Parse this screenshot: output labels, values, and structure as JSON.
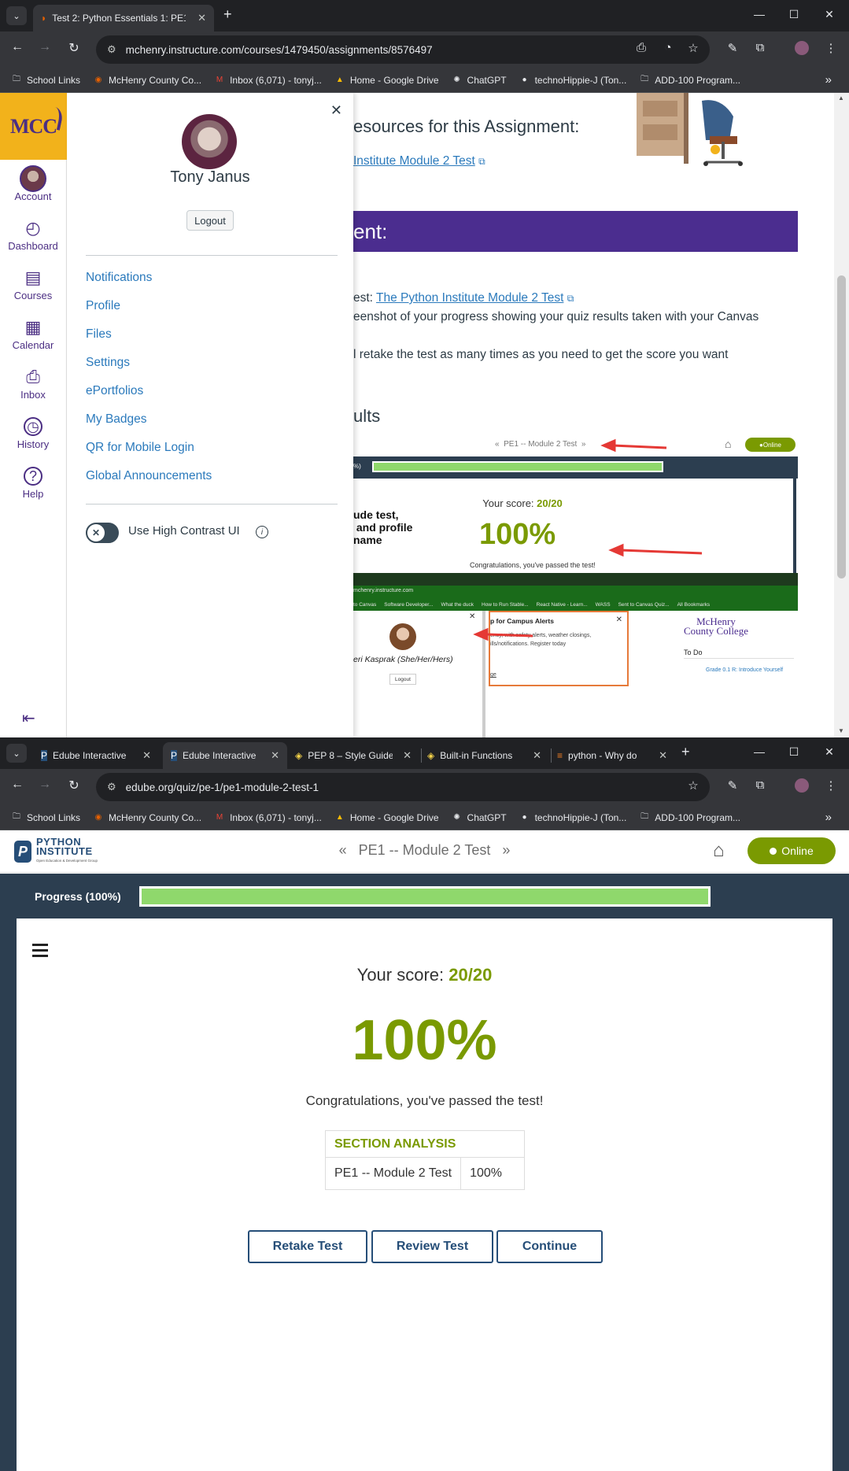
{
  "window1": {
    "tab_title": "Test 2: Python Essentials 1: PE1",
    "url": "mchenry.instructure.com/courses/1479450/assignments/8576497"
  },
  "bookmarks": [
    {
      "label": "School Links",
      "icon": "folder-icon"
    },
    {
      "label": "McHenry County Co...",
      "icon": "canvas-icon"
    },
    {
      "label": "Inbox (6,071) - tonyj...",
      "icon": "gmail-icon"
    },
    {
      "label": "Home - Google Drive",
      "icon": "drive-icon"
    },
    {
      "label": "ChatGPT",
      "icon": "chatgpt-icon"
    },
    {
      "label": "technoHippie-J (Ton...",
      "icon": "github-icon"
    },
    {
      "label": "ADD-100 Program...",
      "icon": "folder-icon"
    }
  ],
  "global_nav": {
    "logo": "MCC",
    "items": [
      {
        "label": "Account",
        "icon": "avatar"
      },
      {
        "label": "Dashboard",
        "icon": "dashboard-icon"
      },
      {
        "label": "Courses",
        "icon": "courses-icon"
      },
      {
        "label": "Calendar",
        "icon": "calendar-icon"
      },
      {
        "label": "Inbox",
        "icon": "inbox-icon"
      },
      {
        "label": "History",
        "icon": "history-icon"
      },
      {
        "label": "Help",
        "icon": "help-icon"
      }
    ]
  },
  "account_tray": {
    "name": "Tony Janus",
    "logout": "Logout",
    "links": [
      "Notifications",
      "Profile",
      "Files",
      "Settings",
      "ePortfolios",
      "My Badges",
      "QR for Mobile Login",
      "Global Announcements"
    ],
    "toggle_label": "Use High Contrast UI",
    "toggle_on": false
  },
  "assignment_page": {
    "resources_heading": "esources for this Assignment:",
    "resource_link": "Institute Module 2 Test",
    "banner": "ent:",
    "line1_prefix": "est: ",
    "line1_link": "The Python Institute Module 2 Test",
    "line2": "eenshot of your progress showing your quiz results taken with your Canvas",
    "line3": "l retake the test as many times as you need to get the score you want",
    "results_heading": "ults",
    "screenshot": {
      "title": "PE1 -- Module 2 Test",
      "online": "Online",
      "score_label": "Your score: ",
      "score": "20/20",
      "percent": "100%",
      "congrats": "Congratulations, you've passed the test!",
      "note": "ude test,\n and profile\nname",
      "url": "mchenry.instructure.com",
      "bookmarks": [
        "to Canvas",
        "Software Developer...",
        "What the duck",
        "How to Run Stable...",
        "React Native - Learn...",
        "WASS",
        "Sent to Canvas Quiz...",
        "All Bookmarks"
      ],
      "person": "eri Kasprak (She/Her/Hers)",
      "logout": "Logout",
      "alert_title": "p for Campus Alerts",
      "alert_body": "ency, with safety alerts, weather closings,\nills/notifications. Register today",
      "alert_footer": "ge",
      "college": "McHenry\nCounty College",
      "todo": "To Do",
      "todo_item": "Grade 0.1 R: Introduce Yourself"
    }
  },
  "window2": {
    "tabs": [
      {
        "title": "Edube Interactive",
        "icon": "edube-icon",
        "active": false
      },
      {
        "title": "Edube Interactive",
        "icon": "edube-icon",
        "active": true
      },
      {
        "title": "PEP 8 – Style Guide",
        "icon": "python-icon",
        "active": false
      },
      {
        "title": "Built-in Functions",
        "icon": "python-icon",
        "active": false
      },
      {
        "title": "python - Why do",
        "icon": "stackoverflow-icon",
        "active": false
      }
    ],
    "url": "edube.org/quiz/pe-1/pe1-module-2-test-1"
  },
  "edube": {
    "logo_line1": "PYTHON",
    "logo_line2": "INSTITUTE",
    "logo_sub": "Open Education & Development Group",
    "title": "PE1 -- Module 2 Test",
    "online": "Online",
    "progress_label": "Progress (100%)",
    "progress": 1.0,
    "score_label": "Your score: ",
    "score": "20/20",
    "percent": "100%",
    "congrats": "Congratulations, you've passed the test!",
    "section_header": "SECTION ANALYSIS",
    "section_rows": [
      {
        "name": "PE1 -- Module 2 Test",
        "value": "100%"
      }
    ],
    "buttons": [
      "Retake Test",
      "Review Test",
      "Continue"
    ]
  },
  "colors": {
    "canvas_purple": "#4b2d8f",
    "mcc_gold": "#f2b21b",
    "edube_green": "#7a9a01",
    "progress_fill": "#8fd86c",
    "edube_navy": "#2c3e50",
    "link_blue": "#2b7abc"
  }
}
